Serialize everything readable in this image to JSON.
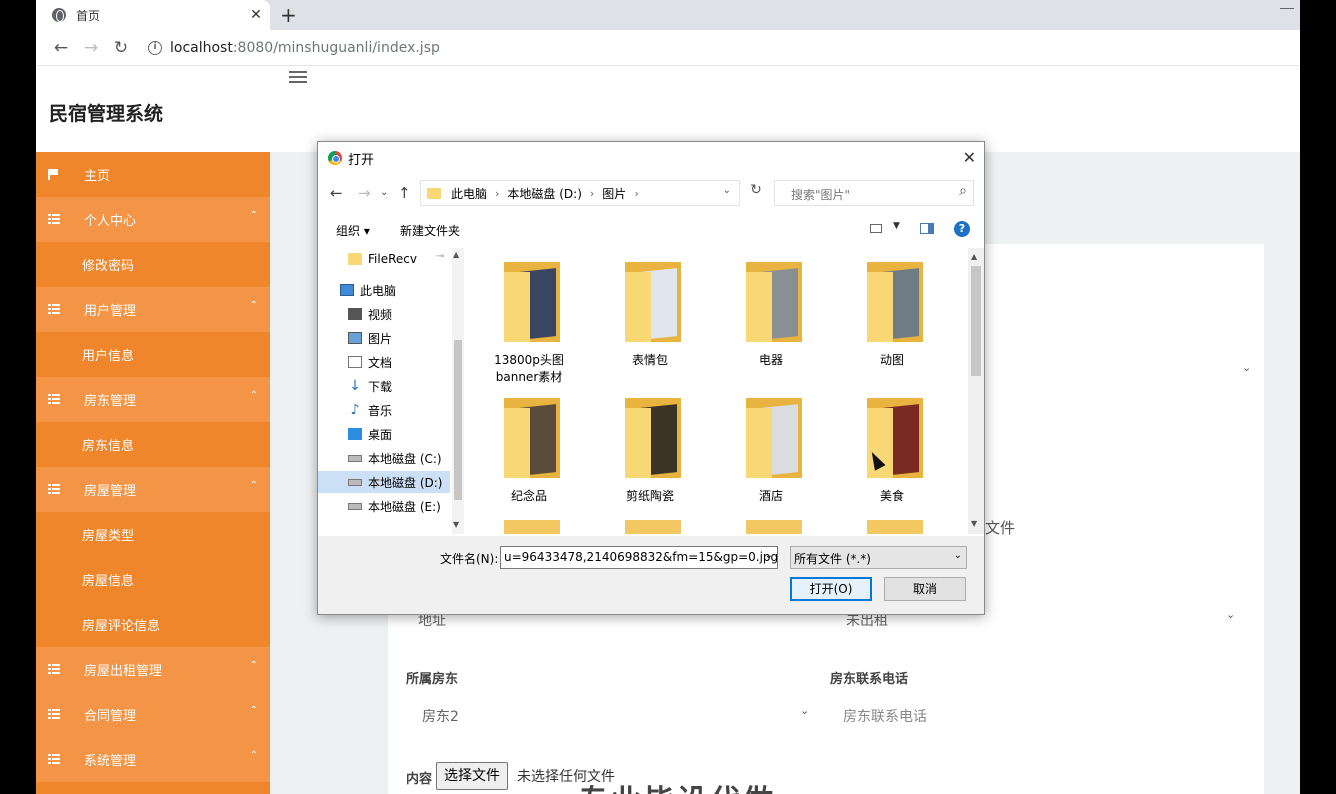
{
  "browser": {
    "tab_title": "首页",
    "tab_close": "✕",
    "new_tab": "+",
    "url_host": "localhost",
    "url_rest": ":8080/minshuguanli/index.jsp"
  },
  "app": {
    "title": "民宿管理系统"
  },
  "sidebar": {
    "items": [
      {
        "label": "主页",
        "kind": "home"
      },
      {
        "label": "个人中心",
        "kind": "parent"
      },
      {
        "label": "修改密码",
        "kind": "child"
      },
      {
        "label": "用户管理",
        "kind": "parent"
      },
      {
        "label": "用户信息",
        "kind": "child"
      },
      {
        "label": "房东管理",
        "kind": "parent"
      },
      {
        "label": "房东信息",
        "kind": "child"
      },
      {
        "label": "房屋管理",
        "kind": "parent"
      },
      {
        "label": "房屋类型",
        "kind": "child"
      },
      {
        "label": "房屋信息",
        "kind": "child"
      },
      {
        "label": "房屋评论信息",
        "kind": "child"
      },
      {
        "label": "房屋出租管理",
        "kind": "parent"
      },
      {
        "label": "合同管理",
        "kind": "parent"
      },
      {
        "label": "系统管理",
        "kind": "parent"
      }
    ]
  },
  "form": {
    "address_placeholder": "地址",
    "status_value": "未出租",
    "landlord_label": "所属房东",
    "landlord_value": "房东2",
    "phone_label": "房东联系电话",
    "phone_placeholder": "房东联系电话",
    "content_label": "内容",
    "file_button": "选择文件",
    "file_none": "未选择任何文件",
    "big_text": "专业毕设代做",
    "ghost_file": "文件"
  },
  "dialog": {
    "title": "打开",
    "close": "✕",
    "breadcrumb": [
      "此电脑",
      "本地磁盘 (D:)",
      "图片"
    ],
    "search_placeholder": "搜索\"图片\"",
    "organize": "组织 ▾",
    "new_folder": "新建文件夹",
    "help": "?",
    "tree": [
      {
        "label": "FileRecv",
        "icon": "folder"
      },
      {
        "label": "此电脑",
        "icon": "pc"
      },
      {
        "label": "视频",
        "icon": "video"
      },
      {
        "label": "图片",
        "icon": "pic"
      },
      {
        "label": "文档",
        "icon": "doc"
      },
      {
        "label": "下载",
        "icon": "down"
      },
      {
        "label": "音乐",
        "icon": "music"
      },
      {
        "label": "桌面",
        "icon": "desk"
      },
      {
        "label": "本地磁盘 (C:)",
        "icon": "drive"
      },
      {
        "label": "本地磁盘 (D:)",
        "icon": "drive",
        "selected": true
      },
      {
        "label": "本地磁盘 (E:)",
        "icon": "drive"
      }
    ],
    "files": [
      {
        "name": "13800p头图banner素材",
        "color": "#3a4660"
      },
      {
        "name": "表情包",
        "color": "#dfe6ee"
      },
      {
        "name": "电器",
        "color": "#8a8f94"
      },
      {
        "name": "动图",
        "color": "#6f7c86"
      },
      {
        "name": "纪念品",
        "color": "#5a4a3c"
      },
      {
        "name": "剪纸陶瓷",
        "color": "#3b3326"
      },
      {
        "name": "酒店",
        "color": "#d9dde0"
      },
      {
        "name": "美食",
        "color": "#7b2a22"
      }
    ],
    "filename_label": "文件名(N):",
    "filename_value": "u=96433478,2140698832&fm=15&gp=0.jpg",
    "filetype_value": "所有文件 (*.*)",
    "open_button": "打开(O)",
    "cancel_button": "取消"
  },
  "colors": {
    "sidebar": "#f0862b",
    "sidebar_parent": "#f39446",
    "accent_blue": "#0078d7"
  }
}
